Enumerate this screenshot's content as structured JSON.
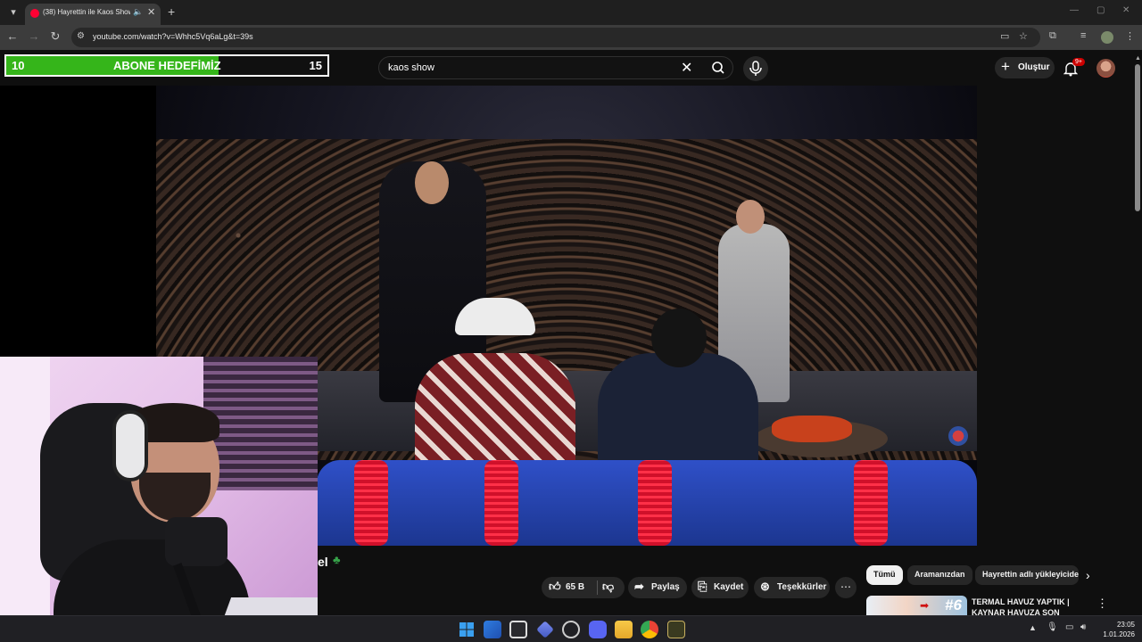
{
  "browser": {
    "tab_title": "(38) Hayrettin ile Kaos Show",
    "url": "youtube.com/watch?v=Whhc5Vq6aLg&t=39s"
  },
  "goal_widget": {
    "start": "10",
    "label": "ABONE HEDEFİMİZ",
    "target": "15",
    "progress_fraction": 0.66
  },
  "youtube": {
    "search_query": "kaos show",
    "create_label": "Oluştur",
    "notifications_badge": "9+",
    "video_title_visible": "el",
    "actions": {
      "like_count": "65 B",
      "share": "Paylaş",
      "save": "Kaydet",
      "thanks": "Teşekkürler"
    },
    "chips": [
      "Tümü",
      "Aramanızdan",
      "Hayrettin adlı yükleyiciden"
    ],
    "related": {
      "title": "TERMAL HAVUZ YAPTIK | KAYNAR HAVUZA SON DÜŞEN",
      "thumb_badge": "#6"
    }
  },
  "taskbar": {
    "time": "23:05",
    "date": "1.01.2026"
  },
  "icons": [
    "tab-list-icon",
    "audio-icon",
    "close-icon",
    "new-tab-icon",
    "back-icon",
    "forward-icon",
    "reload-icon",
    "site-info-icon",
    "search-icon",
    "clear-icon",
    "mic-icon",
    "plus-icon",
    "bell-icon",
    "like-icon",
    "dislike-icon",
    "share-icon",
    "save-icon",
    "thanks-icon",
    "more-icon",
    "chevron-right-icon"
  ],
  "colors": {
    "goal_fill": "#35b51a",
    "youtube_bg": "#0f0f0f",
    "sofa_blue": "#2f50c8",
    "notif_red": "#cc0000"
  }
}
